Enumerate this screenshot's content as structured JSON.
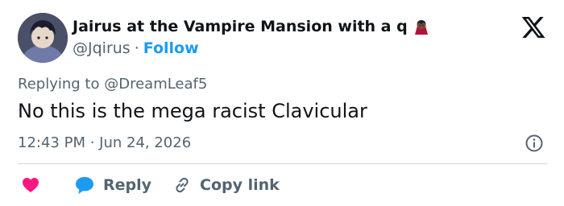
{
  "author": {
    "name": "Jairus at the Vampire Mansion with a q",
    "handle": "@Jqirus",
    "separator": "·",
    "follow_label": "Follow",
    "name_emoji": "vampire-emoji"
  },
  "reply_context": {
    "prefix": "Replying to",
    "target": "@DreamLeaf5"
  },
  "tweet": {
    "text": "No this is the mega racist Clavicular",
    "timestamp": "12:43 PM · Jun 24, 2026"
  },
  "actions": {
    "like_icon": "heart-icon",
    "reply_label": "Reply",
    "copy_link_label": "Copy link"
  },
  "colors": {
    "accent": "#1d9bf0",
    "like": "#f91880",
    "text_primary": "#0f1419",
    "text_secondary": "#536471",
    "divider": "#cfd9de"
  }
}
